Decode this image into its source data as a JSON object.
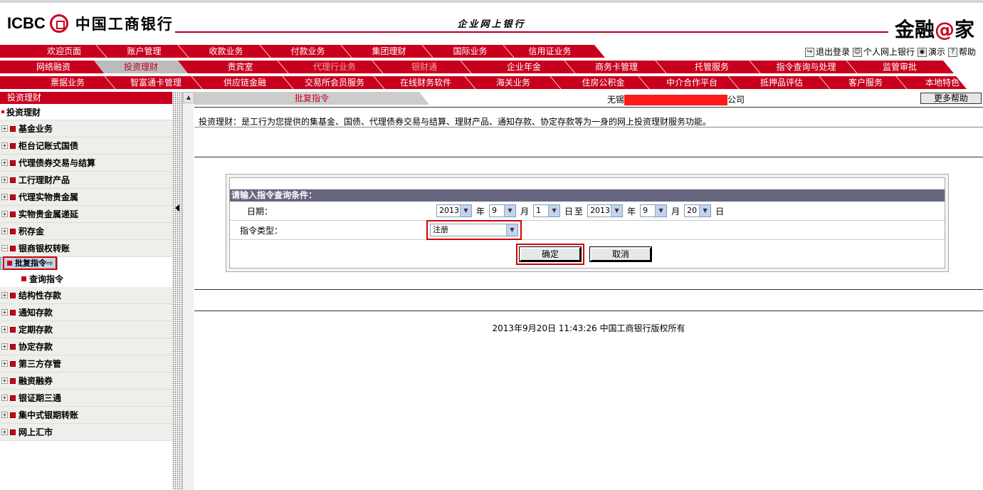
{
  "header": {
    "logo_en": "ICBC",
    "logo_cn": "中国工商银行",
    "subtitle": "企业网上银行",
    "brand_left": "金融",
    "brand_at": "@",
    "brand_right": "家"
  },
  "toplinks": [
    {
      "label": "退出登录"
    },
    {
      "label": "个人网上银行"
    },
    {
      "label": "演示"
    },
    {
      "label": "帮助"
    }
  ],
  "nav": {
    "row1": [
      "欢迎页面",
      "账户管理",
      "收款业务",
      "付款业务",
      "集团理财",
      "国际业务",
      "信用证业务"
    ],
    "row2": [
      "网络融资",
      "投资理财",
      "贵宾室",
      "代理行业务",
      "银财通",
      "企业年金",
      "商务卡管理",
      "托管服务",
      "指令查询与处理",
      "监管审批"
    ],
    "row3": [
      "票据业务",
      "智富通卡管理",
      "供应链金融",
      "交易所会员服务",
      "在线财务软件",
      "海关业务",
      "住房公积金",
      "中介合作平台",
      "抵押品评估",
      "客户服务",
      "本地特色"
    ],
    "active": "投资理财"
  },
  "sidebar": {
    "title": "投资理财",
    "root": "投资理财",
    "items": [
      "基金业务",
      "柜台记账式国债",
      "代理债券交易与结算",
      "工行理财产品",
      "代理实物贵金属",
      "实物贵金属递延",
      "积存金"
    ],
    "expanded": "银商银权转账",
    "subitems": [
      "批复指令",
      "查询指令"
    ],
    "items2": [
      "结构性存款",
      "通知存款",
      "定期存款",
      "协定存款",
      "第三方存管",
      "融资融券",
      "银证期三通",
      "集中式银期转账",
      "网上汇市"
    ]
  },
  "main": {
    "breadcrumb": "批复指令",
    "company_prefix": "无锡",
    "company_suffix": "公司",
    "help_button": "更多帮助",
    "description": "投资理财：是工行为您提供的集基金、国债、代理债券交易与结算、理财产品、通知存款、协定存款等为一身的网上投资理财服务功能。"
  },
  "form": {
    "heading": "请输入指令查询条件：",
    "date_label": "日期：",
    "from": {
      "year": "2013",
      "month": "9",
      "day": "1"
    },
    "to": {
      "year": "2013",
      "month": "9",
      "day": "20"
    },
    "unit_year": "年",
    "unit_month": "月",
    "unit_day": "日",
    "to_word": "至",
    "type_label": "指令类型：",
    "type_value": "注册",
    "ok": "确定",
    "cancel": "取消"
  },
  "footer": "2013年9月20日 11:43:26     中国工商银行版权所有",
  "colors": {
    "brand_red": "#c8001e",
    "form_header": "#666680"
  }
}
